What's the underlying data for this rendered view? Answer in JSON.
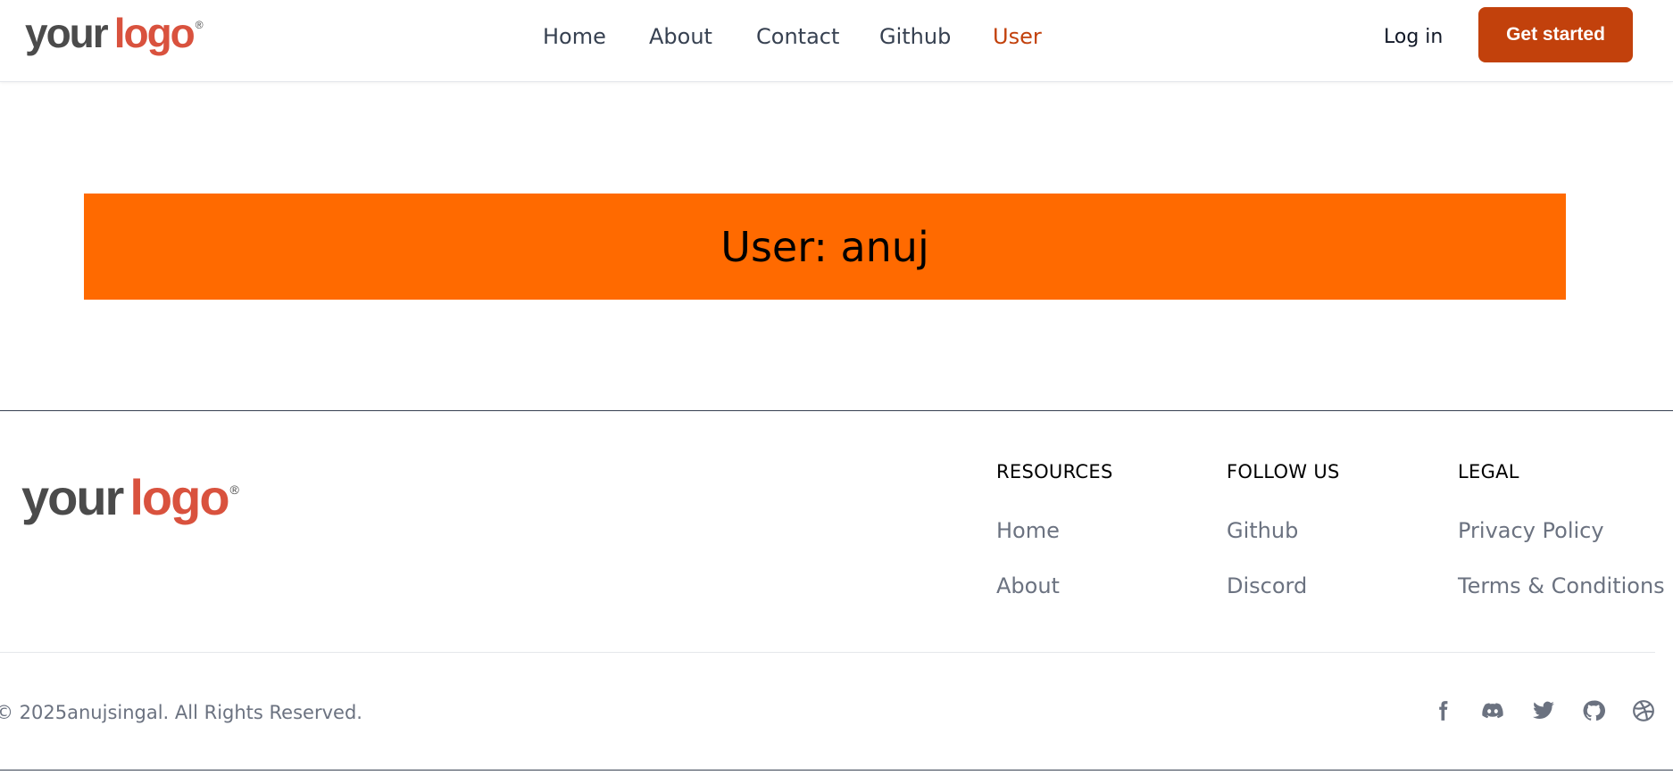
{
  "header": {
    "logo": {
      "word1": "your",
      "word2": "logo",
      "mark": "®"
    },
    "nav": [
      {
        "label": "Home",
        "active": false
      },
      {
        "label": "About",
        "active": false
      },
      {
        "label": "Contact",
        "active": false
      },
      {
        "label": "Github",
        "active": false
      },
      {
        "label": "User",
        "active": true
      }
    ],
    "login_label": "Log in",
    "cta_label": "Get started"
  },
  "main": {
    "banner_text": "User: anuj",
    "banner_color": "#ff6a00"
  },
  "footer": {
    "logo": {
      "word1": "your",
      "word2": "logo",
      "mark": "®"
    },
    "columns": [
      {
        "heading": "RESOURCES",
        "links": [
          "Home",
          "About"
        ]
      },
      {
        "heading": "FOLLOW US",
        "links": [
          "Github",
          "Discord"
        ]
      },
      {
        "heading": "LEGAL",
        "links": [
          "Privacy Policy",
          "Terms & Conditions"
        ]
      }
    ],
    "copyright": "© 2025anujsingal. All Rights Reserved.",
    "socials": [
      "facebook-icon",
      "discord-icon",
      "twitter-icon",
      "github-icon",
      "dribbble-icon"
    ]
  },
  "colors": {
    "accent": "#c2410c",
    "logo_red": "#d9523e",
    "text_muted": "#6b7280"
  }
}
